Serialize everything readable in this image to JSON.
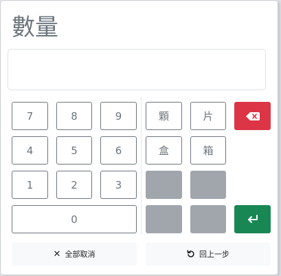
{
  "dialog": {
    "title": "數量",
    "display_value": ""
  },
  "numpad": {
    "keys": [
      "7",
      "8",
      "9",
      "4",
      "5",
      "6",
      "1",
      "2",
      "3",
      "0"
    ]
  },
  "units": {
    "keys": [
      "顆",
      "片",
      "盒",
      "箱"
    ]
  },
  "actions": {
    "clear_all_label": "全部取消",
    "undo_label": "回上一步"
  },
  "icons": {
    "backspace": "backspace-icon",
    "enter": "enter-icon",
    "close": "close-icon",
    "undo": "undo-icon"
  },
  "colors": {
    "danger": "#dc3545",
    "success": "#198754",
    "blank": "#a1a6ad",
    "key_border": "#6c757d"
  }
}
